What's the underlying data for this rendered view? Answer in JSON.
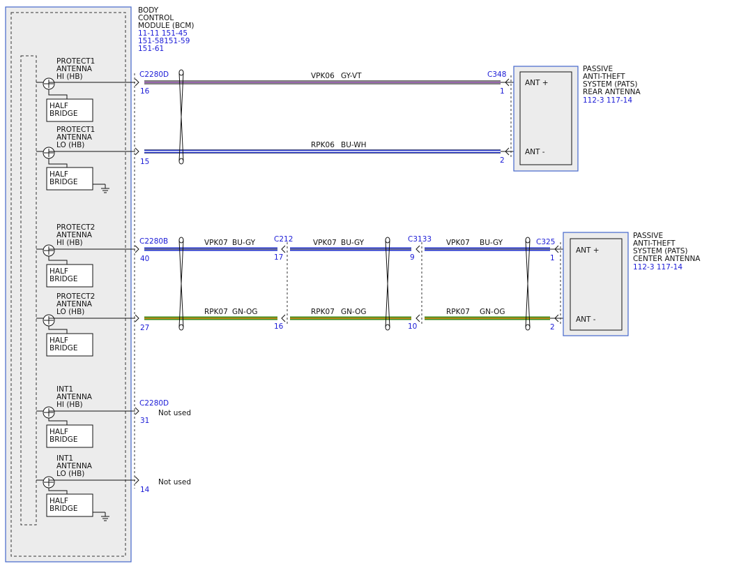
{
  "bcm": {
    "title_lines": [
      "BODY",
      "CONTROL",
      "MODULE (BCM)"
    ],
    "ref_lines": [
      "11-11  151-45",
      "151-58151-59",
      "151-61"
    ],
    "channels": [
      {
        "label_lines": [
          "PROTECT1",
          "ANTENNA",
          "HI (HB)"
        ],
        "bridge_lines": [
          "HALF",
          "BRIDGE"
        ],
        "connector": "C2280D",
        "pin": "16",
        "ground": false
      },
      {
        "label_lines": [
          "PROTECT1",
          "ANTENNA",
          "LO (HB)"
        ],
        "bridge_lines": [
          "HALF",
          "BRIDGE"
        ],
        "connector": "",
        "pin": "15",
        "ground": true
      },
      {
        "label_lines": [
          "PROTECT2",
          "ANTENNA",
          "HI (HB)"
        ],
        "bridge_lines": [
          "HALF",
          "BRIDGE"
        ],
        "connector": "C2280B",
        "pin": "40",
        "ground": false
      },
      {
        "label_lines": [
          "PROTECT2",
          "ANTENNA",
          "LO (HB)"
        ],
        "bridge_lines": [
          "HALF",
          "BRIDGE"
        ],
        "connector": "",
        "pin": "27",
        "ground": false
      },
      {
        "label_lines": [
          "INT1",
          "ANTENNA",
          "HI (HB)"
        ],
        "bridge_lines": [
          "HALF",
          "BRIDGE"
        ],
        "connector": "C2280D",
        "pin": "31",
        "ground": false,
        "note": "Not used"
      },
      {
        "label_lines": [
          "INT1",
          "ANTENNA",
          "LO (HB)"
        ],
        "bridge_lines": [
          "HALF",
          "BRIDGE"
        ],
        "connector": "",
        "pin": "14",
        "ground": true,
        "note": "Not used"
      }
    ]
  },
  "wires": [
    {
      "circuit": "VPK06",
      "color_code": "GY-VT",
      "color_a": "#8a8a8a",
      "color_b": "#9b59b6"
    },
    {
      "circuit": "RPK06",
      "color_code": "BU-WH",
      "color_a": "#2233cc",
      "color_b": "#ffffff"
    },
    {
      "circuit": "VPK07",
      "color_code": "BU-GY",
      "color_a": "#2233cc",
      "color_b": "#8a8a8a"
    },
    {
      "circuit": "RPK07",
      "color_code": "GN-OG",
      "color_a": "#3a8a1a",
      "color_b": "#e08a1a"
    }
  ],
  "inline_connectors": [
    {
      "name": "C212",
      "pin_top": "17",
      "pin_bottom": "16"
    },
    {
      "name": "C3133",
      "pin_top": "9",
      "pin_bottom": "10"
    }
  ],
  "rear_antenna": {
    "title_lines": [
      "PASSIVE",
      "ANTI-THEFT",
      "SYSTEM (PATS)",
      "REAR ANTENNA"
    ],
    "ref": "112-3  117-14",
    "connector": "C348",
    "pin_top": "1",
    "pin_bottom": "2",
    "label_top": "ANT +",
    "label_bottom": "ANT -"
  },
  "center_antenna": {
    "title_lines": [
      "PASSIVE",
      "ANTI-THEFT",
      "SYSTEM (PATS)",
      "CENTER ANTENNA"
    ],
    "ref": "112-3  117-14",
    "connector": "C325",
    "pin_top": "1",
    "pin_bottom": "2",
    "label_top": "ANT +",
    "label_bottom": "ANT -"
  },
  "colors": {
    "line": "#111111",
    "module_border": "#4466cc",
    "module_fill": "#ececec",
    "ref_text": "#1a1ad6"
  }
}
